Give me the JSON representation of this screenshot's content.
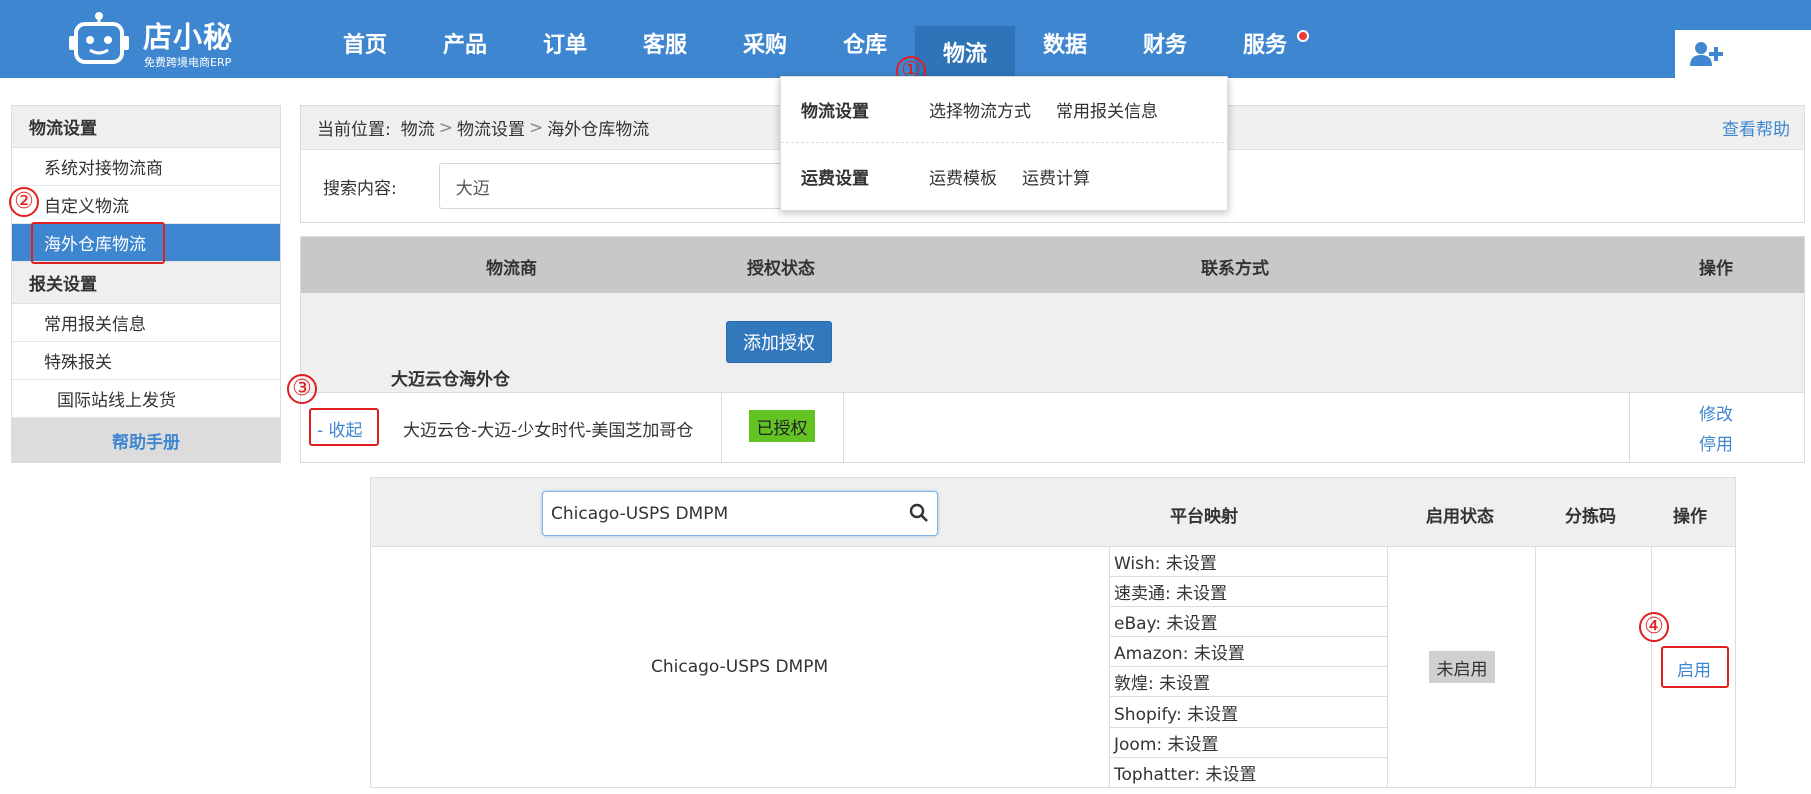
{
  "logo": {
    "brand": "店小秘",
    "slogan": "免费跨境电商ERP"
  },
  "nav": {
    "items": [
      "首页",
      "产品",
      "订单",
      "客服",
      "采购",
      "仓库",
      "物流",
      "数据",
      "财务",
      "服务"
    ],
    "active_index": 6,
    "badge_on": "服务"
  },
  "dropdown": {
    "row1": {
      "title": "物流设置",
      "links": [
        "选择物流方式",
        "常用报关信息"
      ]
    },
    "row2": {
      "title": "运费设置",
      "links": [
        "运费模板",
        "运费计算"
      ]
    }
  },
  "sidebar": {
    "section1": "物流设置",
    "items1": [
      "系统对接物流商",
      "自定义物流",
      "海外仓库物流"
    ],
    "active_item": "海外仓库物流",
    "section2": "报关设置",
    "items2": [
      "常用报关信息",
      "特殊报关"
    ],
    "sub_item": "国际站线上发货",
    "help": "帮助手册"
  },
  "breadcrumb": {
    "prefix": "当前位置:",
    "path": [
      "物流",
      "物流设置",
      "海外仓库物流"
    ],
    "help": "查看帮助"
  },
  "search": {
    "label": "搜索内容:",
    "value": "大迈"
  },
  "logistics_table": {
    "headers": [
      "物流商",
      "授权状态",
      "联系方式",
      "操作"
    ],
    "group": {
      "name": "大迈云仓海外仓",
      "button": "添加授权"
    },
    "row": {
      "toggle": "- 收起",
      "warehouse": "大迈云仓-大迈-少女时代-美国芝加哥仓",
      "auth_status": "已授权",
      "actions": [
        "修改",
        "停用"
      ]
    }
  },
  "service_table": {
    "search_value": "Chicago-USPS DMPM",
    "headers": [
      "平台映射",
      "启用状态",
      "分拣码",
      "操作"
    ],
    "service_name": "Chicago-USPS DMPM",
    "mappings": [
      "Wish: 未设置",
      "速卖通: 未设置",
      "eBay: 未设置",
      "Amazon: 未设置",
      "敦煌: 未设置",
      "Shopify: 未设置",
      "Joom: 未设置",
      "Tophatter: 未设置"
    ],
    "status": "未启用",
    "action": "启用"
  },
  "annotations": [
    "①",
    "②",
    "③",
    "④"
  ],
  "colors": {
    "nav_bg": "#3e87d0",
    "accent_red": "#e02020",
    "auth_green": "#62c322",
    "primary_btn": "#3278bd"
  },
  "icons": [
    "robot-logo-icon",
    "user-add-icon",
    "search-icon"
  ]
}
